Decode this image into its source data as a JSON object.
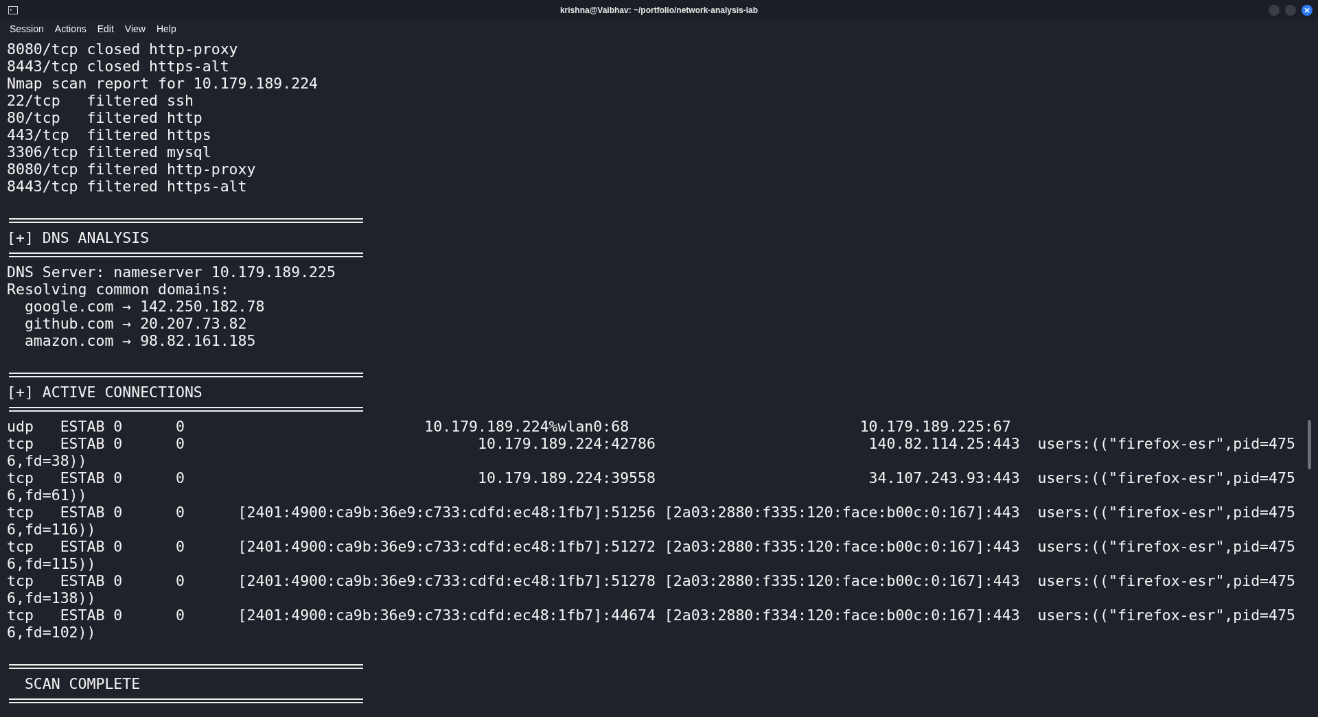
{
  "window": {
    "title": "krishna@Vaibhav: ~/portfolio/network-analysis-lab"
  },
  "menu": [
    "Session",
    "Actions",
    "Edit",
    "View",
    "Help"
  ],
  "terminal_lines": [
    {
      "kind": "text",
      "text": "8080/tcp closed http-proxy"
    },
    {
      "kind": "text",
      "text": "8443/tcp closed https-alt"
    },
    {
      "kind": "text",
      "text": "Nmap scan report for 10.179.189.224"
    },
    {
      "kind": "text",
      "text": "22/tcp   filtered ssh"
    },
    {
      "kind": "text",
      "text": "80/tcp   filtered http"
    },
    {
      "kind": "text",
      "text": "443/tcp  filtered https"
    },
    {
      "kind": "text",
      "text": "3306/tcp filtered mysql"
    },
    {
      "kind": "text",
      "text": "8080/tcp filtered http-proxy"
    },
    {
      "kind": "text",
      "text": "8443/tcp filtered https-alt"
    },
    {
      "kind": "blank"
    },
    {
      "kind": "rule"
    },
    {
      "kind": "text",
      "text": "[+] DNS ANALYSIS"
    },
    {
      "kind": "rule"
    },
    {
      "kind": "text",
      "text": "DNS Server: nameserver 10.179.189.225"
    },
    {
      "kind": "text",
      "text": "Resolving common domains:"
    },
    {
      "kind": "text",
      "text": "  google.com → 142.250.182.78"
    },
    {
      "kind": "text",
      "text": "  github.com → 20.207.73.82"
    },
    {
      "kind": "text",
      "text": "  amazon.com → 98.82.161.185"
    },
    {
      "kind": "blank"
    },
    {
      "kind": "rule"
    },
    {
      "kind": "text",
      "text": "[+] ACTIVE CONNECTIONS"
    },
    {
      "kind": "rule"
    },
    {
      "kind": "text",
      "text": "udp   ESTAB 0      0                           10.179.189.224%wlan0:68                          10.179.189.225:67"
    },
    {
      "kind": "text",
      "text": "tcp   ESTAB 0      0                                 10.179.189.224:42786                        140.82.114.25:443  users:((\"firefox-esr\",pid=475"
    },
    {
      "kind": "text",
      "text": "6,fd=38))"
    },
    {
      "kind": "text",
      "text": "tcp   ESTAB 0      0                                 10.179.189.224:39558                        34.107.243.93:443  users:((\"firefox-esr\",pid=475"
    },
    {
      "kind": "text",
      "text": "6,fd=61))"
    },
    {
      "kind": "text",
      "text": "tcp   ESTAB 0      0      [2401:4900:ca9b:36e9:c733:cdfd:ec48:1fb7]:51256 [2a03:2880:f335:120:face:b00c:0:167]:443  users:((\"firefox-esr\",pid=475"
    },
    {
      "kind": "text",
      "text": "6,fd=116))"
    },
    {
      "kind": "text",
      "text": "tcp   ESTAB 0      0      [2401:4900:ca9b:36e9:c733:cdfd:ec48:1fb7]:51272 [2a03:2880:f335:120:face:b00c:0:167]:443  users:((\"firefox-esr\",pid=475"
    },
    {
      "kind": "text",
      "text": "6,fd=115))"
    },
    {
      "kind": "text",
      "text": "tcp   ESTAB 0      0      [2401:4900:ca9b:36e9:c733:cdfd:ec48:1fb7]:51278 [2a03:2880:f335:120:face:b00c:0:167]:443  users:((\"firefox-esr\",pid=475"
    },
    {
      "kind": "text",
      "text": "6,fd=138))"
    },
    {
      "kind": "text",
      "text": "tcp   ESTAB 0      0      [2401:4900:ca9b:36e9:c733:cdfd:ec48:1fb7]:44674 [2a03:2880:f334:120:face:b00c:0:167]:443  users:((\"firefox-esr\",pid=475"
    },
    {
      "kind": "text",
      "text": "6,fd=102))"
    },
    {
      "kind": "blank"
    },
    {
      "kind": "rule"
    },
    {
      "kind": "text",
      "text": "  SCAN COMPLETE"
    },
    {
      "kind": "rule"
    }
  ]
}
